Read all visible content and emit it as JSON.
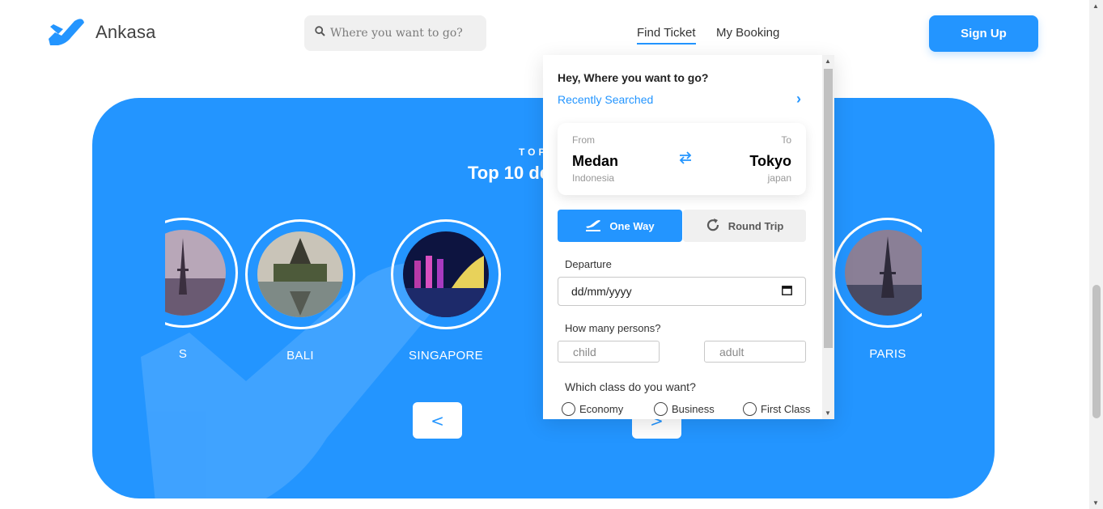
{
  "header": {
    "brand": "Ankasa",
    "search_placeholder": "Where you want to go?",
    "nav": {
      "find_ticket": "Find Ticket",
      "my_booking": "My Booking"
    },
    "signup_label": "Sign Up"
  },
  "hero": {
    "kicker": "TOP",
    "title": "Top 10 de",
    "destinations": [
      "S",
      "BALI",
      "SINGAPORE",
      "PARIS"
    ],
    "prev_label": "<",
    "next_label": ">"
  },
  "popup": {
    "question": "Hey, Where you want to go?",
    "recent_label": "Recently Searched",
    "from": {
      "label": "From",
      "city": "Medan",
      "country": "Indonesia"
    },
    "to": {
      "label": "To",
      "city": "Tokyo",
      "country": "japan"
    },
    "trip": {
      "one_way": "One Way",
      "round_trip": "Round Trip"
    },
    "departure_label": "Departure",
    "departure_value": "dd/mm/yyyy",
    "persons_label": "How many persons?",
    "child_placeholder": "child",
    "adult_placeholder": "adult",
    "class_label": "Which class do you want?",
    "classes": [
      "Economy",
      "Business",
      "First Class"
    ]
  },
  "colors": {
    "brand": "#2395ff",
    "panel": "#2395ff"
  }
}
